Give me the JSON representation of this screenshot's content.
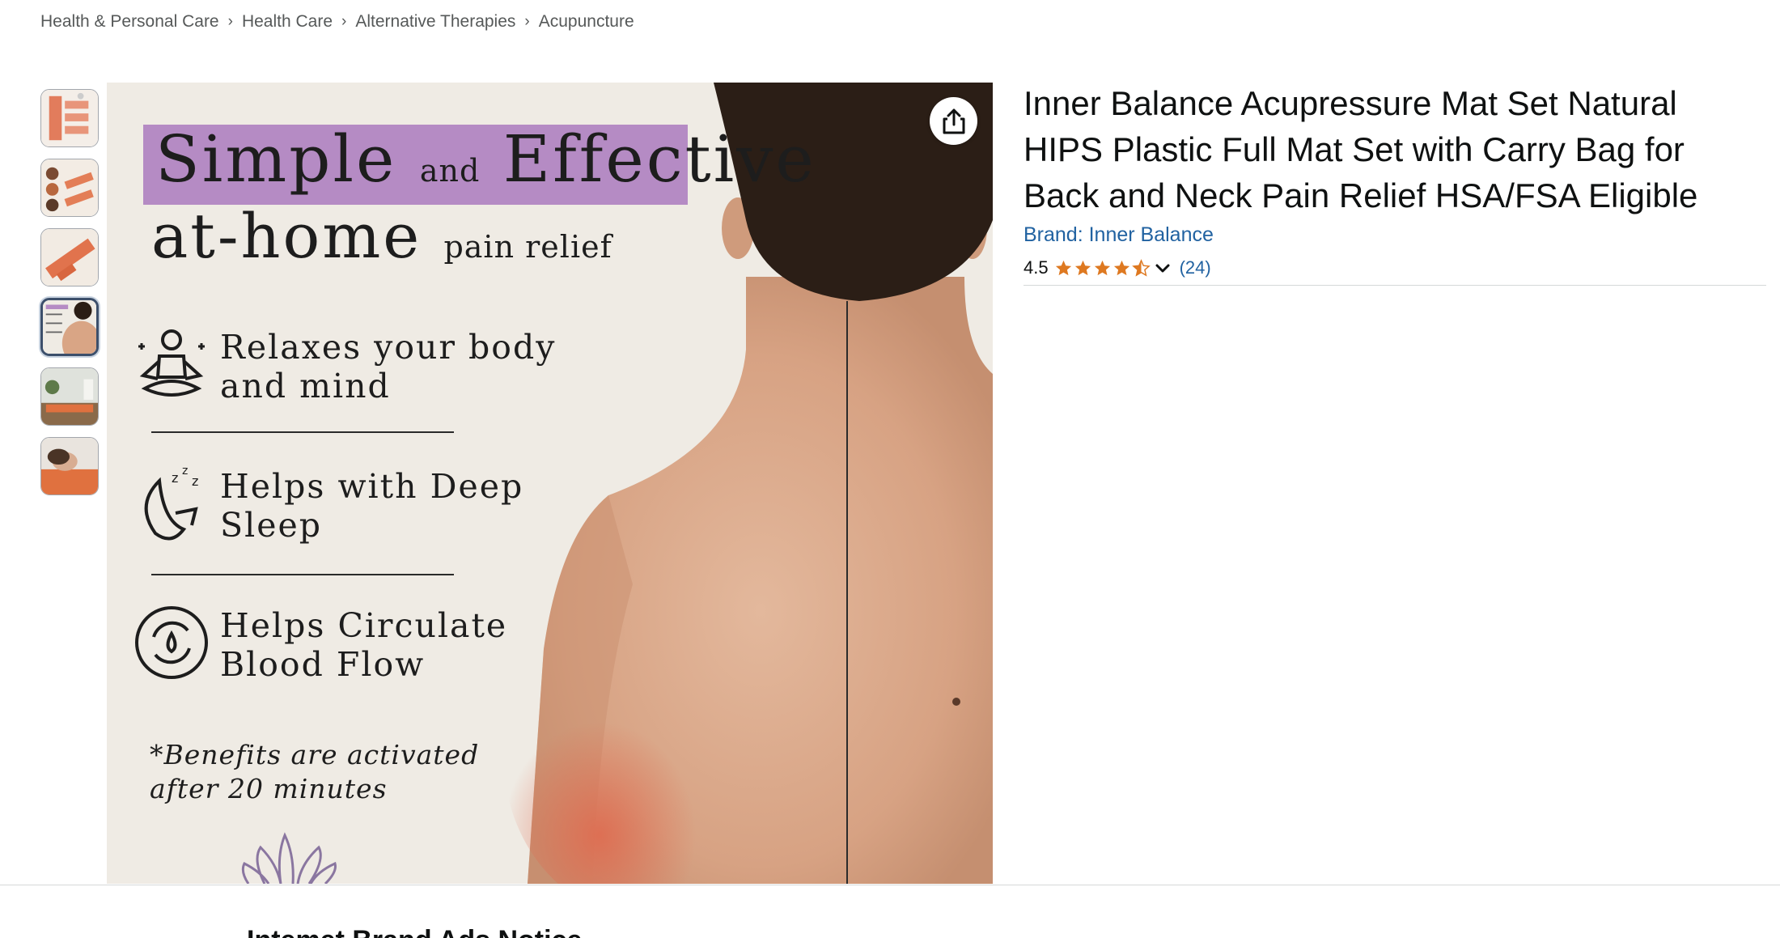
{
  "breadcrumb": [
    "Health & Personal Care",
    "Health Care",
    "Alternative Therapies",
    "Acupuncture"
  ],
  "thumbnails": [
    {
      "icon": "product-grid-thumbnail",
      "active": false
    },
    {
      "icon": "nodes-chart-thumbnail",
      "active": false
    },
    {
      "icon": "mat-set-thumbnail",
      "active": false
    },
    {
      "icon": "back-benefits-thumbnail",
      "active": true
    },
    {
      "icon": "room-mat-thumbnail",
      "active": false
    },
    {
      "icon": "woman-on-mat-thumbnail",
      "active": false
    }
  ],
  "main_image": {
    "headline_1": "Simple",
    "headline_1_small": "and",
    "headline_1_end": "Effective",
    "headline_2": "at-home",
    "headline_2_small": "pain relief",
    "benefits": [
      {
        "line1": "Relaxes your body",
        "line2": "and mind",
        "icon": "meditation-icon"
      },
      {
        "line1": "Helps with Deep",
        "line2": "Sleep",
        "icon": "sleep-moon-icon"
      },
      {
        "line1": "Helps Circulate",
        "line2": "Blood Flow",
        "icon": "circulation-icon"
      }
    ],
    "note_line1": "*Benefits are activated",
    "note_line2": "after 20 minutes",
    "headline_bg_color": "#b58bc4"
  },
  "product": {
    "title": "Inner Balance Acupressure Mat Set Natural HIPS Plastic Full Mat Set with Carry Bag for Back and Neck Pain Relief HSA/FSA Eligible",
    "brand": "Brand: Inner Balance",
    "rating": "4.5",
    "rating_value": 4.5,
    "review_count": "(24)",
    "star_color": "#de7921",
    "link_color": "#2162a1"
  },
  "bottom_heading": "Intemet Brand Ads Notice"
}
